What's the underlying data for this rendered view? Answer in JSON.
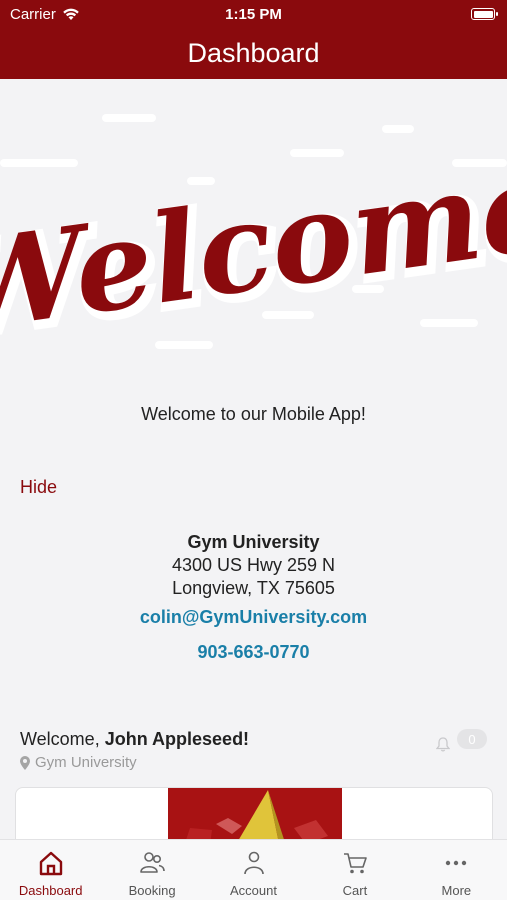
{
  "status_bar": {
    "carrier": "Carrier",
    "time": "1:15 PM"
  },
  "header": {
    "title": "Dashboard"
  },
  "hero": {
    "script_text": "Welcome",
    "accent_color": "#8a0a0d"
  },
  "welcome_message": "Welcome to our Mobile App!",
  "hide_label": "Hide",
  "gym": {
    "name": "Gym University",
    "address_line1": "4300 US Hwy 259 N",
    "address_line2": "Longview, TX 75605",
    "email": "colin@GymUniversity.com",
    "phone": "903-663-0770"
  },
  "user": {
    "greeting_prefix": "Welcome, ",
    "name": "John Appleseed!",
    "location": "Gym University"
  },
  "notifications": {
    "count": "0"
  },
  "tabs": [
    {
      "label": "Dashboard",
      "icon": "home-icon",
      "active": true
    },
    {
      "label": "Booking",
      "icon": "people-icon",
      "active": false
    },
    {
      "label": "Account",
      "icon": "person-icon",
      "active": false
    },
    {
      "label": "Cart",
      "icon": "cart-icon",
      "active": false
    },
    {
      "label": "More",
      "icon": "more-dots-icon",
      "active": false
    }
  ]
}
